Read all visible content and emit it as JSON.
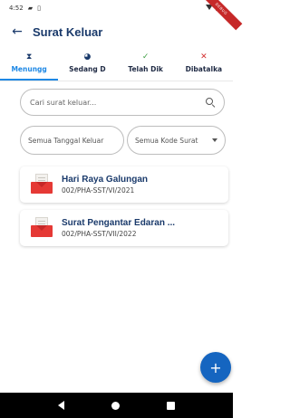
{
  "status_bar": {
    "time": "4:52",
    "icons": [
      "sd-card-icon",
      "sim-icon",
      "wifi-icon",
      "battery-icon"
    ],
    "ribbon": "DEBUG"
  },
  "app_bar": {
    "back_icon": "arrow-left-icon",
    "title": "Surat Keluar"
  },
  "tabs": [
    {
      "icon": "⧗",
      "icon_name": "hourglass-icon",
      "label": "Menungg",
      "active": true
    },
    {
      "icon": "◕",
      "icon_name": "clock-icon",
      "label": "Sedang D",
      "active": false
    },
    {
      "icon": "✓",
      "icon_name": "check-icon",
      "label": "Telah Dik",
      "active": false
    },
    {
      "icon": "✕",
      "icon_name": "close-icon",
      "label": "Dibatalka",
      "active": false
    }
  ],
  "search": {
    "placeholder": "Cari surat keluar...",
    "value": ""
  },
  "filters": {
    "date_label": "Semua Tanggal Keluar",
    "code_label": "Semua Kode Surat"
  },
  "letters": [
    {
      "title": "Hari Raya Galungan",
      "number": "002/PHA-SST/VI/2021"
    },
    {
      "title": "Surat Pengantar Edaran ...",
      "number": "002/PHA-SST/VII/2022"
    }
  ],
  "fab": {
    "label": "+"
  },
  "colors": {
    "primary": "#1a3a6b",
    "accent": "#1e88e5",
    "fab": "#1565c0",
    "envelope": "#e53935"
  }
}
